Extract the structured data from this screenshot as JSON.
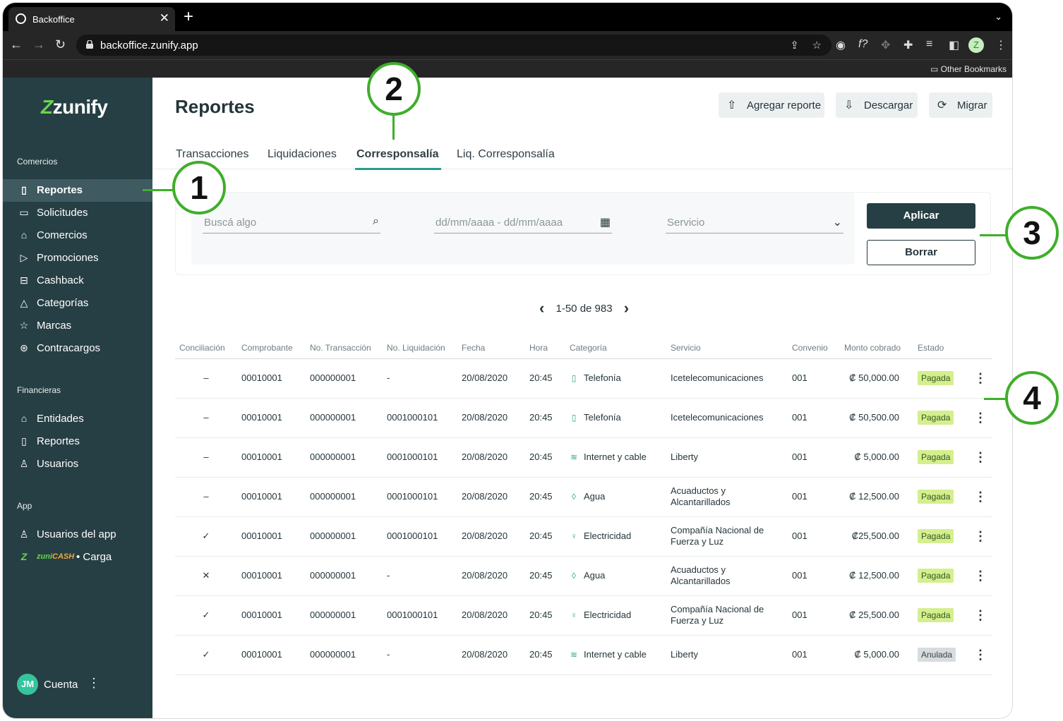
{
  "browser": {
    "tab_title": "Backoffice",
    "tab_close": "✕",
    "new_tab": "+",
    "tab_menu": "⌄",
    "url": "backoffice.zunify.app",
    "bookmarks_label": "Other Bookmarks",
    "profile_initial": "Z",
    "icons": [
      "back-arrow-icon",
      "forward-arrow-icon",
      "reload-icon",
      "lock-icon",
      "share-icon",
      "star-icon",
      "camera-icon",
      "function-icon",
      "move-icon",
      "puzzle-icon",
      "playlist-icon",
      "sidebar-icon",
      "kebab-icon",
      "folder-icon"
    ]
  },
  "sidebar": {
    "logo_mark": "Z",
    "logo_text": "zunify",
    "sections": {
      "comercios": "Comercios",
      "financieras": "Financieras",
      "app": "App"
    },
    "items": {
      "reportes": "Reportes",
      "solicitudes": "Solicitudes",
      "comercios": "Comercios",
      "promociones": "Promociones",
      "cashback": "Cashback",
      "categorias": "Categorías",
      "marcas": "Marcas",
      "contracargos": "Contracargos",
      "entidades": "Entidades",
      "reportes_fin": "Reportes",
      "usuarios": "Usuarios",
      "usuarios_app": "Usuarios del app",
      "zunicash_zuni": "zuni",
      "zunicash_cash": "CASH",
      "carga": "• Carga"
    },
    "account": {
      "initials": "JM",
      "label": "Cuenta",
      "menu": "⋮"
    }
  },
  "header": {
    "title": "Reportes",
    "buttons": {
      "agregar": "Agregar reporte",
      "descargar": "Descargar",
      "migrar": "Migrar"
    }
  },
  "tabs": {
    "transacciones": "Transacciones",
    "liquidaciones": "Liquidaciones",
    "corresponsalia": "Corresponsalía",
    "liq_corresponsalia": "Liq. Corresponsalía"
  },
  "filters": {
    "search_placeholder": "Buscá algo",
    "date_placeholder": "dd/mm/aaaa  -  dd/mm/aaaa",
    "service_placeholder": "Servicio",
    "apply": "Aplicar",
    "clear": "Borrar"
  },
  "pagination": {
    "range": "1-50 de 983",
    "prev": "‹",
    "next": "›"
  },
  "table": {
    "headers": {
      "conciliacion": "Conciliación",
      "comprobante": "Comprobante",
      "no_transaccion": "No. Transacción",
      "no_liquidacion": "No. Liquidación",
      "fecha": "Fecha",
      "hora": "Hora",
      "categoria": "Categoría",
      "servicio": "Servicio",
      "convenio": "Convenio",
      "monto": "Monto cobrado",
      "estado": "Estado"
    },
    "rows": [
      {
        "conc": "–",
        "comp": "00010001",
        "trx": "000000001",
        "liq": "-",
        "fecha": "20/08/2020",
        "hora": "20:45",
        "cat_icon": "▯",
        "cat": "Telefonía",
        "serv1": "Icetelecomunicaciones",
        "serv2": "",
        "conv": "001",
        "monto": "₡ 50,000.00",
        "estado": "Pagada"
      },
      {
        "conc": "–",
        "comp": "00010001",
        "trx": "000000001",
        "liq": "0001000101",
        "fecha": "20/08/2020",
        "hora": "20:45",
        "cat_icon": "▯",
        "cat": "Telefonía",
        "serv1": "Icetelecomunicaciones",
        "serv2": "",
        "conv": "001",
        "monto": "₡ 50,500.00",
        "estado": "Pagada"
      },
      {
        "conc": "–",
        "comp": "00010001",
        "trx": "000000001",
        "liq": "0001000101",
        "fecha": "20/08/2020",
        "hora": "20:45",
        "cat_icon": "≋",
        "cat": "Internet y cable",
        "serv1": "Liberty",
        "serv2": "",
        "conv": "001",
        "monto": "₡ 5,000.00",
        "estado": "Pagada"
      },
      {
        "conc": "–",
        "comp": "00010001",
        "trx": "000000001",
        "liq": "0001000101",
        "fecha": "20/08/2020",
        "hora": "20:45",
        "cat_icon": "◊",
        "cat": "Agua",
        "serv1": "Acuaductos y",
        "serv2": "Alcantarillados",
        "conv": "001",
        "monto": "₡ 12,500.00",
        "estado": "Pagada"
      },
      {
        "conc": "✓",
        "comp": "00010001",
        "trx": "000000001",
        "liq": "0001000101",
        "fecha": "20/08/2020",
        "hora": "20:45",
        "cat_icon": "♀",
        "cat": "Electricidad",
        "serv1": "Compañía Nacional de",
        "serv2": "Fuerza y Luz",
        "conv": "001",
        "monto": "₡25,500.00",
        "estado": "Pagada"
      },
      {
        "conc": "✕",
        "comp": "00010001",
        "trx": "000000001",
        "liq": "-",
        "fecha": "20/08/2020",
        "hora": "20:45",
        "cat_icon": "◊",
        "cat": "Agua",
        "serv1": "Acuaductos y",
        "serv2": "Alcantarillados",
        "conv": "001",
        "monto": "₡ 12,500.00",
        "estado": "Pagada"
      },
      {
        "conc": "✓",
        "comp": "00010001",
        "trx": "000000001",
        "liq": "0001000101",
        "fecha": "20/08/2020",
        "hora": "20:45",
        "cat_icon": "♀",
        "cat": "Electricidad",
        "serv1": "Compañía Nacional de",
        "serv2": "Fuerza y Luz",
        "conv": "001",
        "monto": "₡ 25,500.00",
        "estado": "Pagada"
      },
      {
        "conc": "✓",
        "comp": "00010001",
        "trx": "000000001",
        "liq": "-",
        "fecha": "20/08/2020",
        "hora": "20:45",
        "cat_icon": "≋",
        "cat": "Internet y cable",
        "serv1": "Liberty",
        "serv2": "",
        "conv": "001",
        "monto": "₡ 5,000.00",
        "estado": "Anulada"
      }
    ],
    "row_menu": "⋮"
  },
  "annotations": [
    "1",
    "2",
    "3",
    "4"
  ],
  "colors": {
    "sidebar": "#263f44",
    "accent": "#2a9d8f",
    "annotation": "#3fae2a",
    "badge_paid": "#d4ef8e",
    "badge_void": "#d8dcde"
  }
}
